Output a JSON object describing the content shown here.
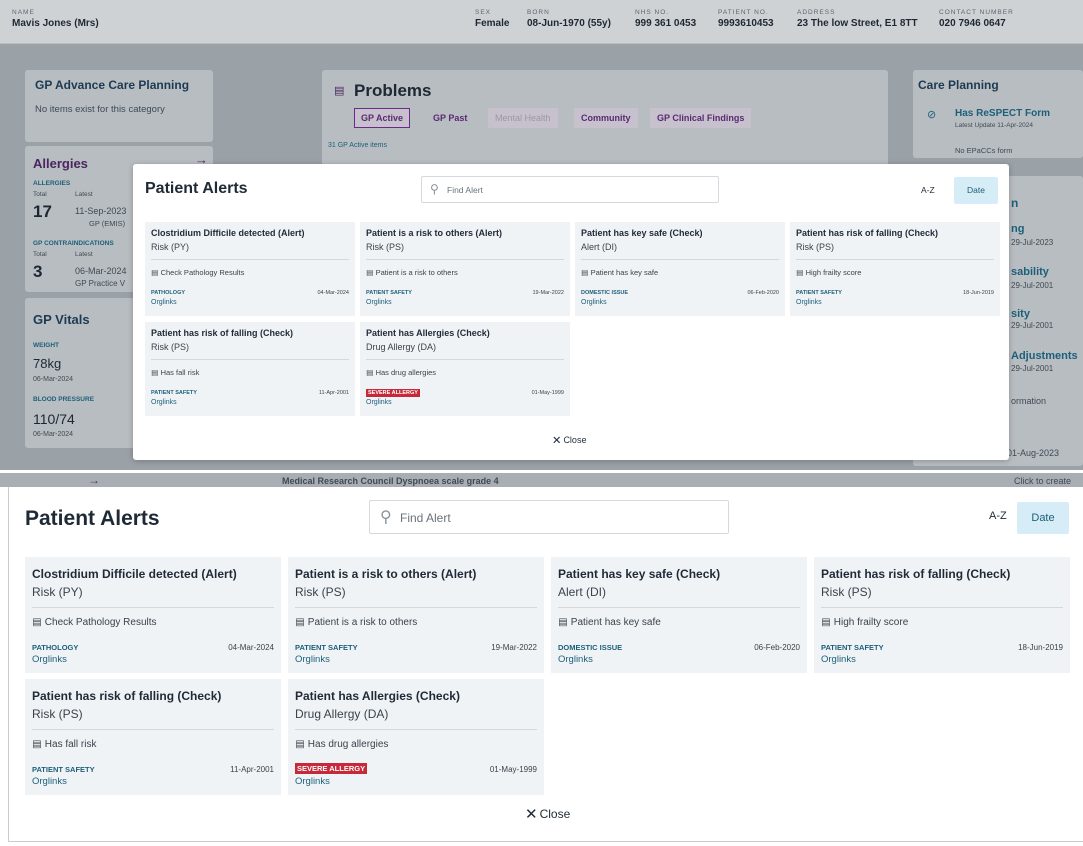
{
  "patient": {
    "name_label": "NAME",
    "name": "Mavis Jones (Mrs)",
    "sex_label": "SEX",
    "sex": "Female",
    "born_label": "BORN",
    "born": "08-Jun-1970 (55y)",
    "nhs_label": "NHS NO.",
    "nhs": "999 361 0453",
    "patient_no_label": "PATIENT NO.",
    "patient_no": "9993610453",
    "address_label": "ADDRESS",
    "address": "23 The low Street, E1 8TT",
    "contact_label": "CONTACT NUMBER",
    "contact": "020 7946 0647"
  },
  "background": {
    "advance_care_title": "GP Advance Care Planning",
    "advance_care_empty": "No items exist for this category",
    "allergies_title": "Allergies",
    "allergies_label": "ALLERGIES",
    "total_label": "Total",
    "latest_label": "Latest",
    "allergies_total": "17",
    "allergies_date": "11-Sep-2023",
    "allergies_source": "GP (EMIS)",
    "contra_label": "GP CONTRAINDICATIONS",
    "contra_total": "3",
    "contra_date": "06-Mar-2024",
    "contra_source": "GP Practice V",
    "vitals_title": "GP Vitals",
    "weight_label": "WEIGHT",
    "weight": "78kg",
    "weight_date": "06-Mar-2024",
    "bp_label": "BLOOD PRESSURE",
    "bp": "110/74",
    "bp_date": "06-Mar-2024",
    "problems_title": "Problems",
    "problems_tabs": [
      "GP Active",
      "GP Past",
      "Mental Health",
      "Community",
      "GP Clinical Findings"
    ],
    "problems_count": "31 GP Active items",
    "problems_row": "Medical Research Council Dyspnoea scale grade 4",
    "care_title": "Care Planning",
    "care_item": "Has ReSPECT Form",
    "care_item_sub": "Latest Update 11-Apr-2024",
    "care_epaccs": "No EPaCCs form",
    "care_create": "Click to create",
    "right_fragments": [
      "n",
      "ng",
      "29-Jul-2023",
      "sability",
      "29-Jul-2001",
      "sity",
      "29-Jul-2001",
      "Adjustments",
      "29-Jul-2001",
      "ormation",
      "01-Aug-2023"
    ]
  },
  "modal": {
    "title": "Patient Alerts",
    "search_placeholder": "Find Alert",
    "sort_az": "A-Z",
    "sort_date": "Date",
    "close": "Close",
    "alerts": [
      {
        "title": "Clostridium Difficile detected (Alert)",
        "type": "Risk (PY)",
        "note": "Check Pathology Results",
        "category": "PATHOLOGY",
        "severe": false,
        "date": "04-Mar-2024",
        "link": "Orglinks"
      },
      {
        "title": "Patient is a risk to others (Alert)",
        "type": "Risk (PS)",
        "note": "Patient is a risk to others",
        "category": "PATIENT SAFETY",
        "severe": false,
        "date": "19-Mar-2022",
        "link": "Orglinks"
      },
      {
        "title": "Patient has key safe (Check)",
        "type": "Alert (DI)",
        "note": "Patient has key safe",
        "category": "DOMESTIC ISSUE",
        "severe": false,
        "date": "06-Feb-2020",
        "link": "Orglinks"
      },
      {
        "title": "Patient has risk of falling (Check)",
        "type": "Risk (PS)",
        "note": "High frailty score",
        "category": "PATIENT SAFETY",
        "severe": false,
        "date": "18-Jun-2019",
        "link": "Orglinks"
      },
      {
        "title": "Patient has risk of falling (Check)",
        "type": "Risk (PS)",
        "note": "Has fall risk",
        "category": "PATIENT SAFETY",
        "severe": false,
        "date": "11-Apr-2001",
        "link": "Orglinks"
      },
      {
        "title": "Patient has Allergies (Check)",
        "type": "Drug Allergy (DA)",
        "note": "Has drug allergies",
        "category": "SEVERE ALLERGY",
        "severe": true,
        "date": "01-May-1999",
        "link": "Orglinks"
      }
    ]
  },
  "icons": {
    "search": "search-icon",
    "note": "note-icon",
    "close": "close-icon",
    "arrow": "arrow-right-icon",
    "check": "check-circle-icon",
    "problems": "problems-icon"
  },
  "colors": {
    "accent": "#1c5f7a",
    "date_button_bg": "#d6ecf6",
    "severe": "#c62a3a",
    "tab_active": "#6b2a8a"
  }
}
